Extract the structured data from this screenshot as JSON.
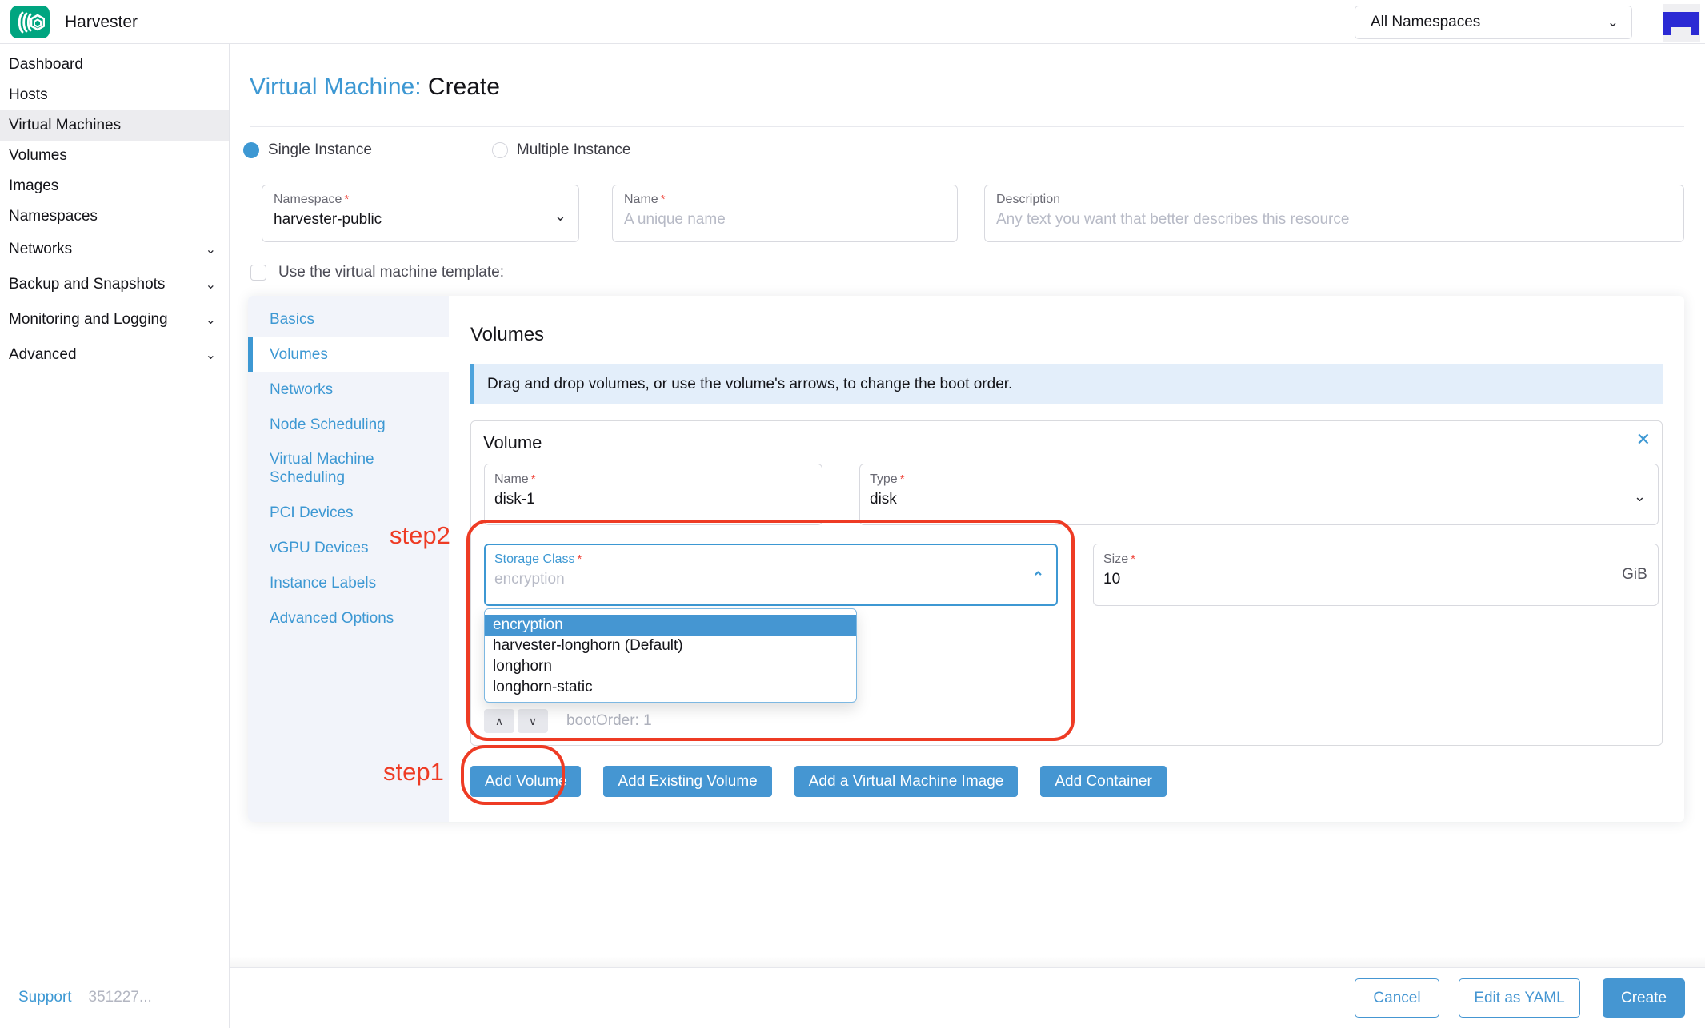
{
  "misc": {
    "required_marker": "*"
  },
  "icons": {
    "chevron_down": "⌄",
    "chevron_up": "⌃",
    "close": "✕",
    "caret_up": "∧",
    "caret_down": "∨"
  },
  "colors": {
    "primary": "#3d98d3",
    "button_blue": "#4596d2",
    "brand_green": "#00a580",
    "annotation_red": "#ee3b24",
    "banner_bg": "#e3eefa",
    "highlight_bg": "#4596d2"
  },
  "header": {
    "brand": "Harvester",
    "namespace_filter": "All Namespaces"
  },
  "sidebar": {
    "items": [
      {
        "label": "Dashboard"
      },
      {
        "label": "Hosts"
      },
      {
        "label": "Virtual Machines",
        "selected": true
      },
      {
        "label": "Volumes"
      },
      {
        "label": "Images"
      },
      {
        "label": "Namespaces"
      },
      {
        "label": "Networks",
        "expandable": true
      },
      {
        "label": "Backup and Snapshots",
        "expandable": true
      },
      {
        "label": "Monitoring and Logging",
        "expandable": true
      },
      {
        "label": "Advanced",
        "expandable": true
      }
    ],
    "footer": {
      "support": "Support",
      "version": "351227..."
    }
  },
  "page": {
    "title_prefix": "Virtual Machine:",
    "title_suffix": "Create",
    "mode_single": "Single Instance",
    "mode_multiple": "Multiple Instance",
    "namespace": {
      "label": "Namespace",
      "value": "harvester-public"
    },
    "name": {
      "label": "Name",
      "placeholder": "A unique name"
    },
    "description": {
      "label": "Description",
      "placeholder": "Any text you want that better describes this resource"
    },
    "template_checkbox": "Use the virtual machine template:"
  },
  "form_nav": {
    "items": [
      "Basics",
      "Volumes",
      "Networks",
      "Node Scheduling",
      "Virtual Machine Scheduling",
      "PCI Devices",
      "vGPU Devices",
      "Instance Labels",
      "Advanced Options"
    ]
  },
  "volumes": {
    "heading": "Volumes",
    "banner": "Drag and drop volumes, or use the volume's arrows, to change the boot order.",
    "card_title": "Volume",
    "name": {
      "label": "Name",
      "value": "disk-1"
    },
    "type": {
      "label": "Type",
      "value": "disk"
    },
    "storage_class": {
      "label": "Storage Class",
      "placeholder": "encryption",
      "options": [
        "encryption",
        "harvester-longhorn (Default)",
        "longhorn",
        "longhorn-static"
      ]
    },
    "size": {
      "label": "Size",
      "value": "10",
      "unit": "GiB"
    },
    "boot_order": "bootOrder: 1",
    "actions": [
      "Add Volume",
      "Add Existing Volume",
      "Add a Virtual Machine Image",
      "Add Container"
    ]
  },
  "annotations": {
    "step1": "step1",
    "step2": "step2"
  },
  "footer": {
    "cancel": "Cancel",
    "edit_yaml": "Edit as YAML",
    "create": "Create"
  }
}
